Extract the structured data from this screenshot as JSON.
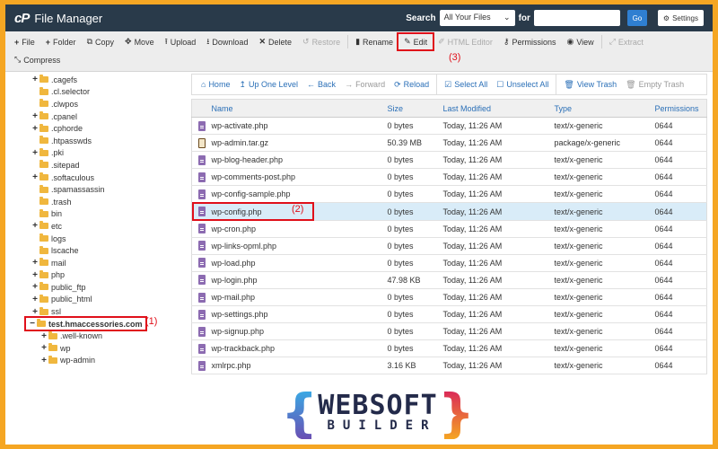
{
  "app": {
    "logo": "cP",
    "title": "File Manager"
  },
  "search": {
    "label": "Search",
    "scope": "All Your Files",
    "for_label": "for",
    "value": "",
    "go_label": "Go",
    "settings_label": "Settings"
  },
  "toolbar": {
    "file": "File",
    "folder": "Folder",
    "copy": "Copy",
    "move": "Move",
    "upload": "Upload",
    "download": "Download",
    "delete": "Delete",
    "restore": "Restore",
    "rename": "Rename",
    "edit": "Edit",
    "html_editor": "HTML Editor",
    "permissions": "Permissions",
    "view": "View",
    "extract": "Extract",
    "compress": "Compress"
  },
  "annotations": {
    "one": "(1)",
    "two": "(2)",
    "three": "(3)"
  },
  "tree": [
    {
      "label": ".cagefs",
      "toggle": "+",
      "level": 1
    },
    {
      "label": ".cl.selector",
      "toggle": "",
      "level": 1
    },
    {
      "label": ".clwpos",
      "toggle": "",
      "level": 1
    },
    {
      "label": ".cpanel",
      "toggle": "+",
      "level": 1
    },
    {
      "label": ".cphorde",
      "toggle": "+",
      "level": 1
    },
    {
      "label": ".htpasswds",
      "toggle": "",
      "level": 1
    },
    {
      "label": ".pki",
      "toggle": "+",
      "level": 1
    },
    {
      "label": ".sitepad",
      "toggle": "",
      "level": 1
    },
    {
      "label": ".softaculous",
      "toggle": "+",
      "level": 1
    },
    {
      "label": ".spamassassin",
      "toggle": "",
      "level": 1
    },
    {
      "label": ".trash",
      "toggle": "",
      "level": 1
    },
    {
      "label": "bin",
      "toggle": "",
      "level": 1
    },
    {
      "label": "etc",
      "toggle": "+",
      "level": 1
    },
    {
      "label": "logs",
      "toggle": "",
      "level": 1
    },
    {
      "label": "lscache",
      "toggle": "",
      "level": 1
    },
    {
      "label": "mail",
      "toggle": "+",
      "level": 1
    },
    {
      "label": "php",
      "toggle": "+",
      "level": 1
    },
    {
      "label": "public_ftp",
      "toggle": "+",
      "level": 1
    },
    {
      "label": "public_html",
      "toggle": "+",
      "level": 1
    },
    {
      "label": "ssl",
      "toggle": "+",
      "level": 1
    },
    {
      "label": "test.hmaccessories.com",
      "toggle": "−",
      "level": 1,
      "bold": true,
      "annotated": true
    },
    {
      "label": ".well-known",
      "toggle": "+",
      "level": 2
    },
    {
      "label": "wp",
      "toggle": "+",
      "level": 2
    },
    {
      "label": "wp-admin",
      "toggle": "+",
      "level": 2
    }
  ],
  "nav": {
    "home": "Home",
    "up": "Up One Level",
    "back": "Back",
    "forward": "Forward",
    "reload": "Reload",
    "select_all": "Select All",
    "unselect_all": "Unselect All",
    "view_trash": "View Trash",
    "empty_trash": "Empty Trash"
  },
  "table": {
    "headers": {
      "name": "Name",
      "size": "Size",
      "modified": "Last Modified",
      "type": "Type",
      "perms": "Permissions"
    },
    "rows": [
      {
        "name": "wp-activate.php",
        "size": "0 bytes",
        "modified": "Today, 11:26 AM",
        "type": "text/x-generic",
        "perms": "0644",
        "icon": "text"
      },
      {
        "name": "wp-admin.tar.gz",
        "size": "50.39 MB",
        "modified": "Today, 11:26 AM",
        "type": "package/x-generic",
        "perms": "0644",
        "icon": "package"
      },
      {
        "name": "wp-blog-header.php",
        "size": "0 bytes",
        "modified": "Today, 11:26 AM",
        "type": "text/x-generic",
        "perms": "0644",
        "icon": "text"
      },
      {
        "name": "wp-comments-post.php",
        "size": "0 bytes",
        "modified": "Today, 11:26 AM",
        "type": "text/x-generic",
        "perms": "0644",
        "icon": "text"
      },
      {
        "name": "wp-config-sample.php",
        "size": "0 bytes",
        "modified": "Today, 11:26 AM",
        "type": "text/x-generic",
        "perms": "0644",
        "icon": "text"
      },
      {
        "name": "wp-config.php",
        "size": "0 bytes",
        "modified": "Today, 11:26 AM",
        "type": "text/x-generic",
        "perms": "0644",
        "icon": "text",
        "selected": true
      },
      {
        "name": "wp-cron.php",
        "size": "0 bytes",
        "modified": "Today, 11:26 AM",
        "type": "text/x-generic",
        "perms": "0644",
        "icon": "text"
      },
      {
        "name": "wp-links-opml.php",
        "size": "0 bytes",
        "modified": "Today, 11:26 AM",
        "type": "text/x-generic",
        "perms": "0644",
        "icon": "text"
      },
      {
        "name": "wp-load.php",
        "size": "0 bytes",
        "modified": "Today, 11:26 AM",
        "type": "text/x-generic",
        "perms": "0644",
        "icon": "text"
      },
      {
        "name": "wp-login.php",
        "size": "47.98 KB",
        "modified": "Today, 11:26 AM",
        "type": "text/x-generic",
        "perms": "0644",
        "icon": "text"
      },
      {
        "name": "wp-mail.php",
        "size": "0 bytes",
        "modified": "Today, 11:26 AM",
        "type": "text/x-generic",
        "perms": "0644",
        "icon": "text"
      },
      {
        "name": "wp-settings.php",
        "size": "0 bytes",
        "modified": "Today, 11:26 AM",
        "type": "text/x-generic",
        "perms": "0644",
        "icon": "text"
      },
      {
        "name": "wp-signup.php",
        "size": "0 bytes",
        "modified": "Today, 11:26 AM",
        "type": "text/x-generic",
        "perms": "0644",
        "icon": "text"
      },
      {
        "name": "wp-trackback.php",
        "size": "0 bytes",
        "modified": "Today, 11:26 AM",
        "type": "text/x-generic",
        "perms": "0644",
        "icon": "text"
      },
      {
        "name": "xmlrpc.php",
        "size": "3.16 KB",
        "modified": "Today, 11:26 AM",
        "type": "text/x-generic",
        "perms": "0644",
        "icon": "text"
      }
    ]
  },
  "brand": {
    "top": "WEBSOFT",
    "bottom": "BUILDER",
    "brace_left": "{",
    "brace_right": "}"
  },
  "colors": {
    "frame": "#f5a623",
    "topbar": "#293a4a",
    "link": "#2a6fb7",
    "annotation": "#e0101a",
    "selected_row": "#d9ecf8",
    "folder": "#f0b73e"
  }
}
